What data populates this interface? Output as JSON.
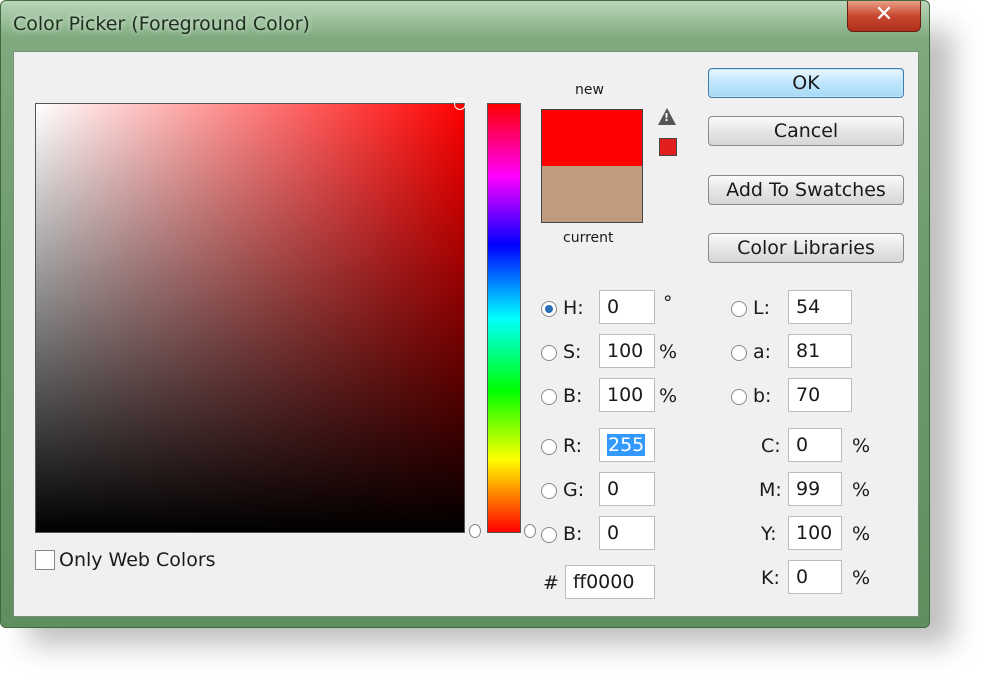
{
  "window": {
    "title": "Color Picker (Foreground Color)",
    "close_glyph": "✕"
  },
  "color_field": {
    "only_web_colors_label": "Only Web Colors",
    "only_web_colors_checked": false
  },
  "swatches": {
    "new_label": "new",
    "current_label": "current",
    "new_color": "#ff0000",
    "current_color": "#c19b7d",
    "gamut_color": "#e21f1f"
  },
  "buttons": {
    "ok": "OK",
    "cancel": "Cancel",
    "add_to_swatches": "Add To Swatches",
    "color_libraries": "Color Libraries"
  },
  "hsb": {
    "h": {
      "label": "H:",
      "value": "0",
      "unit": "°",
      "checked": true
    },
    "s": {
      "label": "S:",
      "value": "100",
      "unit": "%",
      "checked": false
    },
    "b": {
      "label": "B:",
      "value": "100",
      "unit": "%",
      "checked": false
    }
  },
  "rgb": {
    "r": {
      "label": "R:",
      "value": "255",
      "checked": false
    },
    "g": {
      "label": "G:",
      "value": "0",
      "checked": false
    },
    "b": {
      "label": "B:",
      "value": "0",
      "checked": false
    }
  },
  "lab": {
    "l": {
      "label": "L:",
      "value": "54"
    },
    "a": {
      "label": "a:",
      "value": "81"
    },
    "b": {
      "label": "b:",
      "value": "70"
    }
  },
  "cmyk": {
    "c": {
      "label": "C:",
      "value": "0",
      "unit": "%"
    },
    "m": {
      "label": "M:",
      "value": "99",
      "unit": "%"
    },
    "y": {
      "label": "Y:",
      "value": "100",
      "unit": "%"
    },
    "k": {
      "label": "K:",
      "value": "0",
      "unit": "%"
    }
  },
  "hex": {
    "label": "#",
    "value": "ff0000"
  }
}
